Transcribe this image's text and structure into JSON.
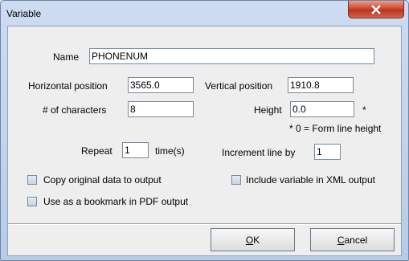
{
  "window": {
    "title": "Variable"
  },
  "form": {
    "name_label": "Name",
    "name_value": "PHONENUM",
    "hpos_label": "Horizontal position",
    "hpos_value": "3565.0",
    "vpos_label": "Vertical position",
    "vpos_value": "1910.8",
    "chars_label": "# of characters",
    "chars_value": "8",
    "height_label": "Height",
    "height_value": "0.0",
    "height_asterisk": "*",
    "height_note": "* 0 = Form line height",
    "repeat_label": "Repeat",
    "repeat_value": "1",
    "times_label": "time(s)",
    "increment_label": "Increment line by",
    "increment_value": "1",
    "copy_original_label": "Copy original data to output",
    "include_xml_label": "Include variable in XML output",
    "bookmark_label": "Use as a bookmark in PDF output"
  },
  "buttons": {
    "ok_mnemonic": "O",
    "ok_rest": "K",
    "cancel_mnemonic": "C",
    "cancel_rest": "ancel"
  },
  "icons": {
    "close": "close-icon"
  }
}
